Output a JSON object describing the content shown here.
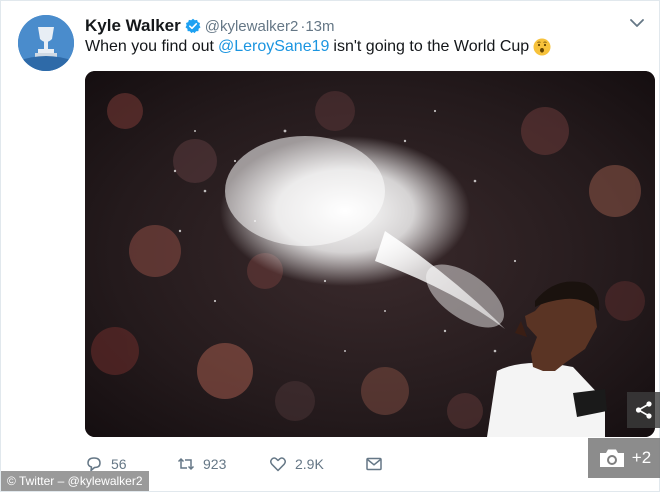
{
  "tweet": {
    "author_name": "Kyle Walker",
    "handle": "@kylewalker2",
    "time": "·13m",
    "text_before": "When you find out",
    "mention": "@LeroySane19",
    "text_after": "isn't going to the World Cup",
    "emoji_icon": "surprised-face-icon"
  },
  "actions": {
    "replies": "56",
    "retweets": "923",
    "likes": "2.9K"
  },
  "overlay": {
    "watermark": "© Twitter – @kylewalker2",
    "photo_count": "+2",
    "share_icon": "share-icon",
    "camera_icon": "camera-icon"
  },
  "colors": {
    "link": "#1b95e0",
    "verified": "#1da1f2",
    "secondary_text": "#657786"
  }
}
